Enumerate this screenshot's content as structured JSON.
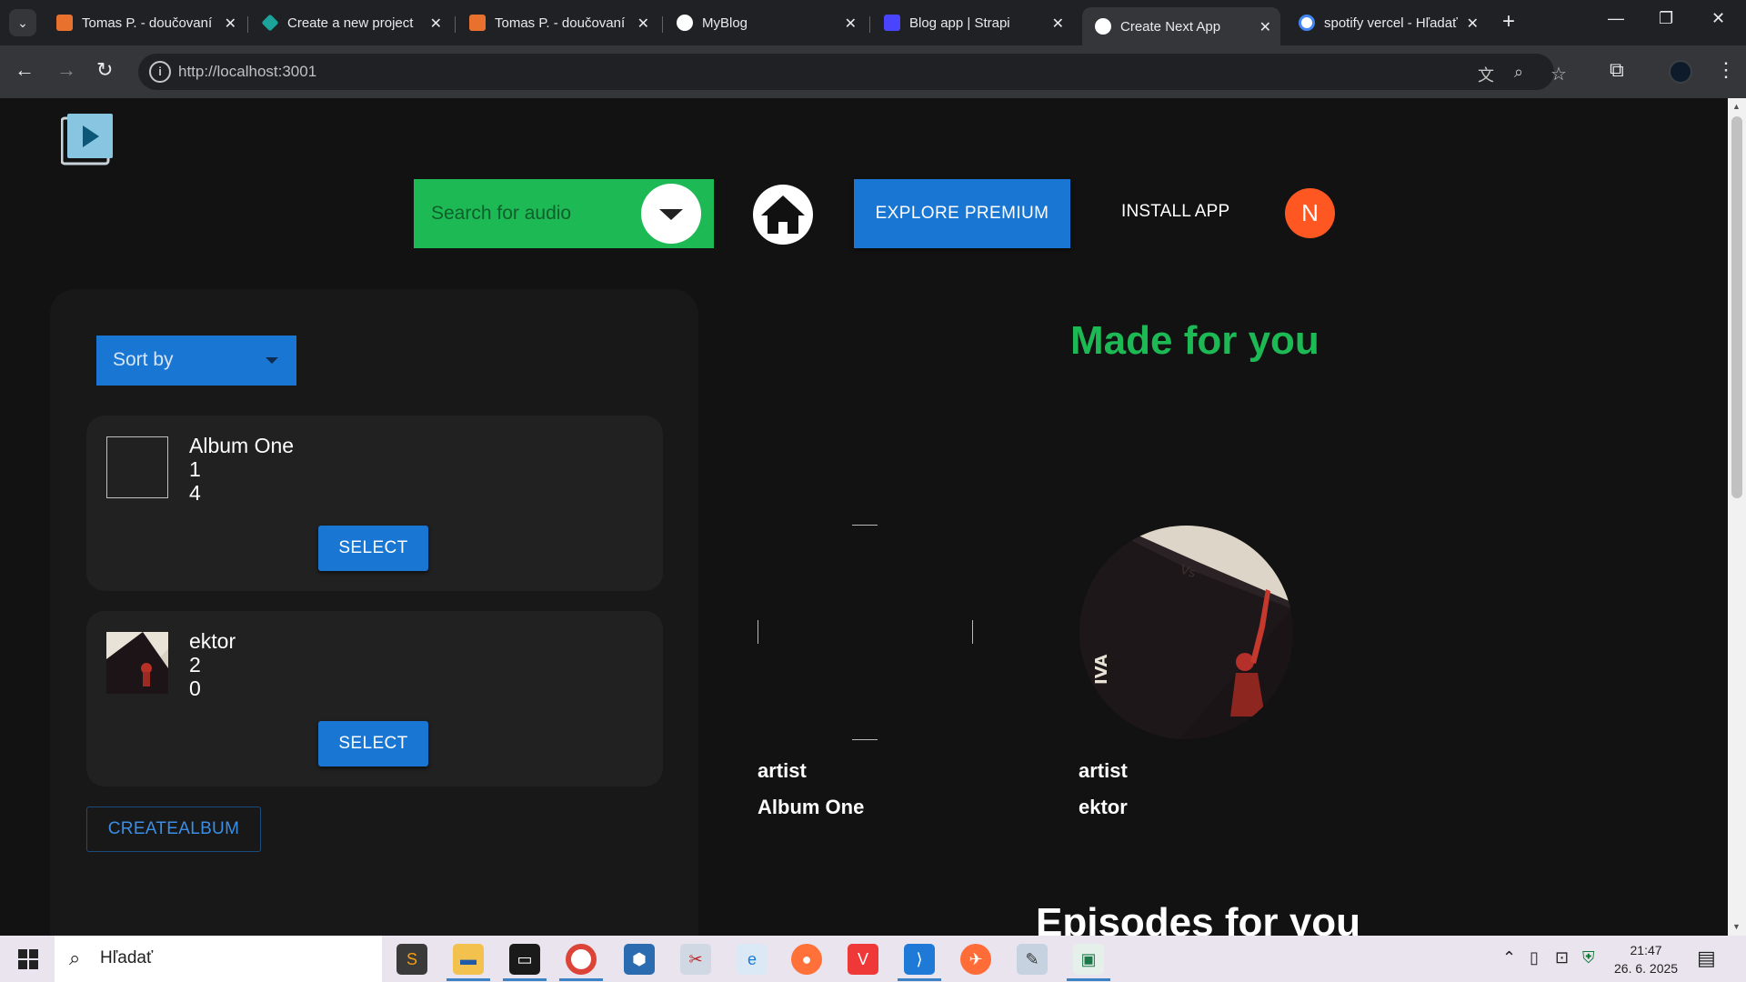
{
  "browser": {
    "tabs": [
      {
        "title": "Tomas P. - doučovaní",
        "favicon": "pencil-favicon",
        "color": "#e8712d"
      },
      {
        "title": "Create a new project",
        "favicon": "diamond-favicon",
        "color": "#1ba39c"
      },
      {
        "title": "Tomas P. - doučovaní",
        "favicon": "pencil-favicon",
        "color": "#e8712d"
      },
      {
        "title": "MyBlog",
        "favicon": "triangle-favicon",
        "color": "#ffffff"
      },
      {
        "title": "Blog app | Strapi",
        "favicon": "strapi-favicon",
        "color": "#4945ff"
      },
      {
        "title": "Create Next App",
        "favicon": "triangle-favicon",
        "color": "#ffffff",
        "active": true
      },
      {
        "title": "spotify vercel - Hľadať",
        "favicon": "google-favicon",
        "color": "#4285f4"
      }
    ],
    "url": "http://localhost:3001"
  },
  "header": {
    "search_placeholder": "Search for audio",
    "premium_label": "EXPLORE PREMIUM",
    "install_label": "INSTALL APP",
    "avatar_initial": "N"
  },
  "sidebar": {
    "sort_label": "Sort by",
    "albums": [
      {
        "name": "Album One",
        "line2": "1",
        "line3": "4",
        "select_label": "SELECT"
      },
      {
        "name": "ektor",
        "line2": "2",
        "line3": "0",
        "select_label": "SELECT"
      }
    ],
    "create_label": "CREATEALBUM"
  },
  "main": {
    "made_for_you": "Made for you",
    "items": [
      {
        "type": "artist",
        "name": "Album One"
      },
      {
        "type": "artist",
        "name": "ektor"
      }
    ],
    "episodes_heading": "Episodes for you"
  },
  "taskbar": {
    "search_text": "Hľadať",
    "time": "21:47",
    "date": "26. 6. 2025"
  },
  "colors": {
    "brand_green": "#1db954",
    "primary_blue": "#1976d2",
    "avatar_orange": "#ff5722"
  }
}
